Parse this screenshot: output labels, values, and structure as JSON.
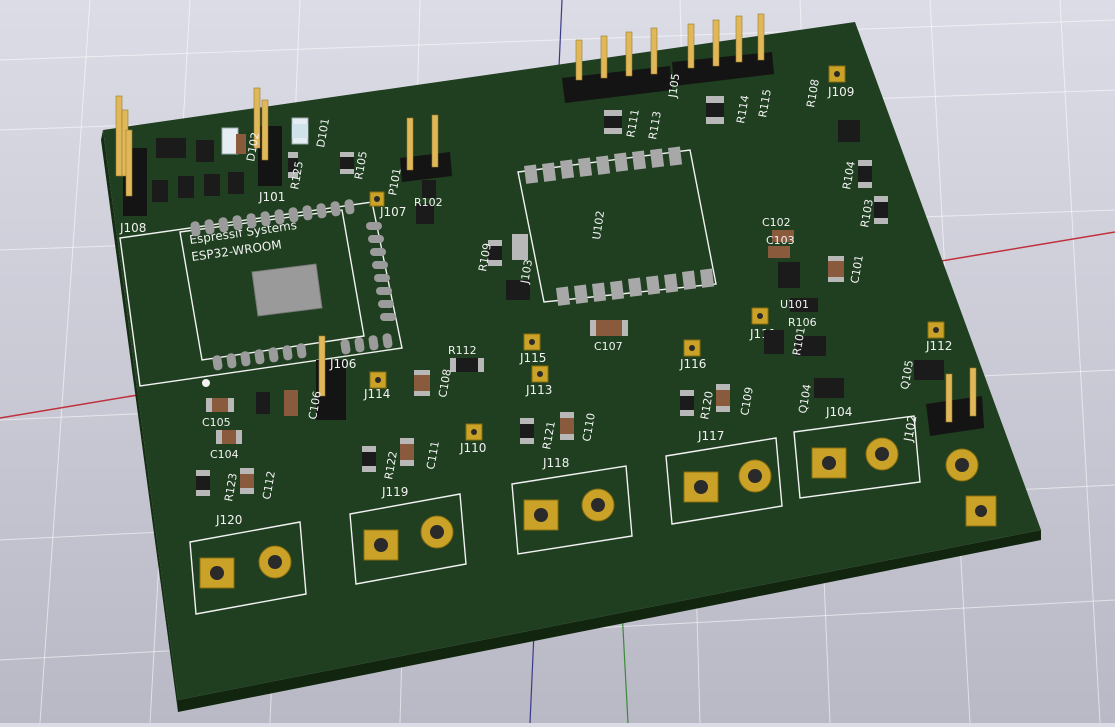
{
  "board": {
    "module_brand": "Espressif Systems",
    "module_model": "ESP32-WROOM"
  },
  "refs": {
    "J108": "J108",
    "J101": "J101",
    "D102": "D102",
    "D101": "D101",
    "R125": "R125",
    "R105": "R105",
    "P101": "P101",
    "J107": "J107",
    "R102": "R102",
    "U102": "U102",
    "R109": "R109",
    "J103": "J103",
    "R111": "R111",
    "R113": "R113",
    "J105": "J105",
    "R114": "R114",
    "R115": "R115",
    "R108": "R108",
    "J109": "J109",
    "R104": "R104",
    "R103": "R103",
    "C102": "C102",
    "C103": "C103",
    "C101": "C101",
    "U101": "U101",
    "J111": "J111",
    "R106": "R106",
    "R101": "R101",
    "C107": "C107",
    "J115": "J115",
    "J113": "J113",
    "R112": "R112",
    "J116": "J116",
    "J114": "J114",
    "C108": "C108",
    "J112": "J112",
    "Q105": "Q105",
    "Q104": "Q104",
    "J104": "J104",
    "J102": "J102",
    "C105": "C105",
    "C104": "C104",
    "C106": "C106",
    "J106": "J106",
    "R120": "R120",
    "C109": "C109",
    "J117": "J117",
    "R121": "R121",
    "C110": "C110",
    "J110": "J110",
    "J118": "J118",
    "R122": "R122",
    "C111": "C111",
    "J119": "J119",
    "R123": "R123",
    "C112": "C112",
    "J120": "J120"
  },
  "colors": {
    "board": "#1f3f20",
    "board_edge": "#12260f",
    "silkscreen": "#f2f2f2",
    "pad_gold": "#c9a227",
    "grid": "#ffffff",
    "axis_red": "#c0303a"
  }
}
